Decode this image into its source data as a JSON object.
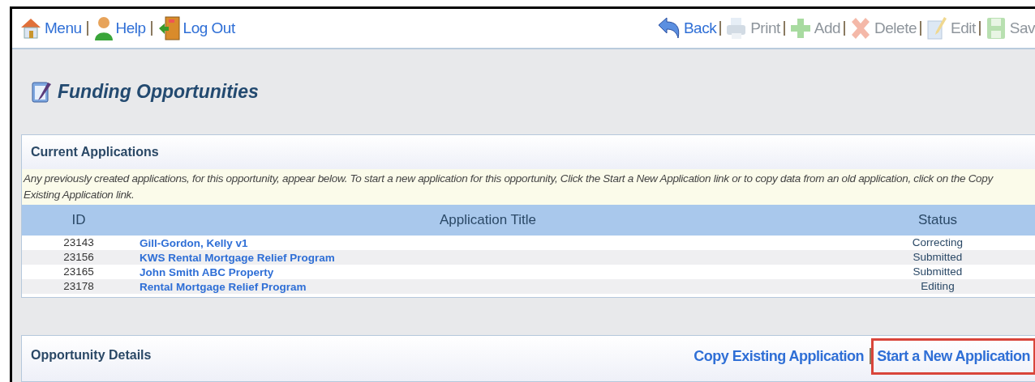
{
  "nav_links": [
    {
      "label": "Menu",
      "kind": "house"
    },
    {
      "label": "Help",
      "kind": "person"
    },
    {
      "label": "Log Out",
      "kind": "door"
    }
  ],
  "toolbar": [
    {
      "label": "Back",
      "kind": "back",
      "disabled": false
    },
    {
      "label": "Print",
      "kind": "printer",
      "disabled": true
    },
    {
      "label": "Add",
      "kind": "plus",
      "disabled": true
    },
    {
      "label": "Delete",
      "kind": "cross",
      "disabled": true
    },
    {
      "label": "Edit",
      "kind": "pencil",
      "disabled": true
    },
    {
      "label": "Sav",
      "kind": "disk",
      "disabled": true
    }
  ],
  "page_title": "Funding Opportunities",
  "current_applications": {
    "title": "Current Applications",
    "description": "Any previously created applications, for this opportunity, appear below. To start a new application for this opportunity, Click the Start a New Application link or to copy data from an old application, click on the Copy Existing Application link.",
    "columns": [
      "ID",
      "Application Title",
      "Status"
    ],
    "rows": [
      {
        "id": "23143",
        "title": "Gill-Gordon, Kelly v1",
        "status": "Correcting"
      },
      {
        "id": "23156",
        "title": "KWS Rental Mortgage Relief Program",
        "status": "Submitted"
      },
      {
        "id": "23165",
        "title": "John Smith ABC Property",
        "status": "Submitted"
      },
      {
        "id": "23178",
        "title": "Rental Mortgage Relief Program",
        "status": "Editing"
      }
    ]
  },
  "opportunity_details": {
    "title": "Opportunity Details",
    "links": [
      {
        "label": "Copy Existing Application",
        "highlighted": false
      },
      {
        "label": "Start a New Application",
        "highlighted": true
      }
    ]
  }
}
